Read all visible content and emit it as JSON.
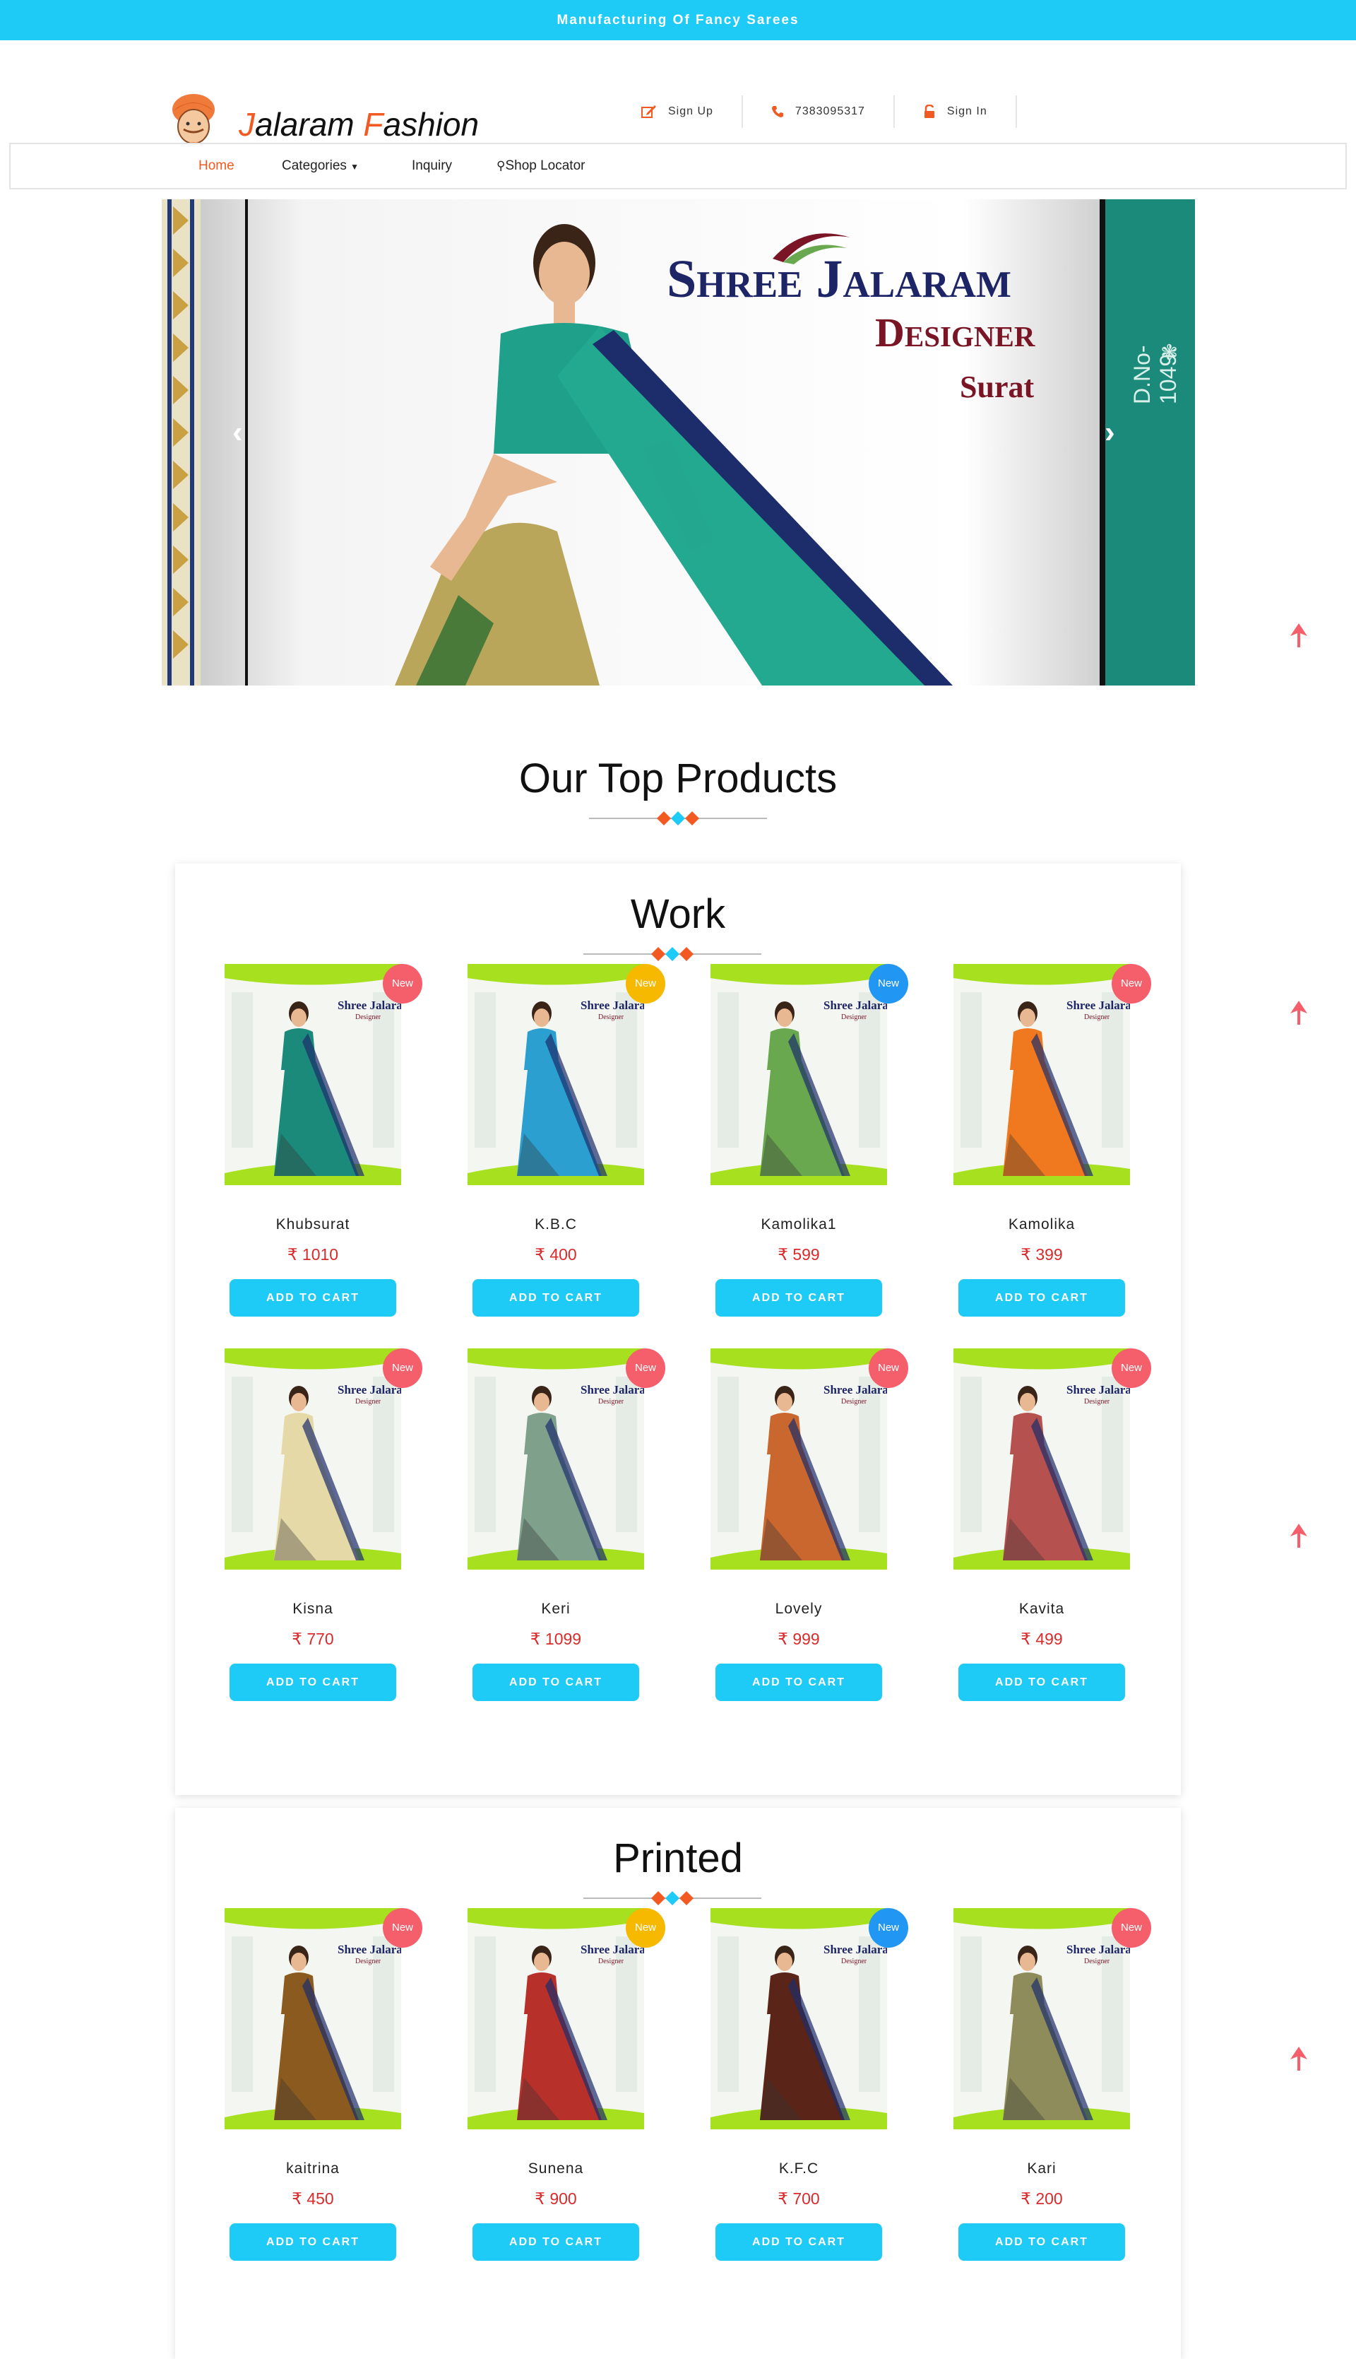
{
  "topbar": {
    "text": "Manufacturing Of Fancy Sarees"
  },
  "header": {
    "logo": {
      "first": "J",
      "first_rest": "alaram ",
      "second": "F",
      "second_rest": "ashion"
    },
    "links": [
      {
        "label": "Sign Up",
        "icon": "edit-icon"
      },
      {
        "label": "7383095317",
        "icon": "phone-icon"
      },
      {
        "label": "Sign In",
        "icon": "unlock-icon"
      }
    ]
  },
  "nav": {
    "home": "Home",
    "categories": "Categories",
    "inquiry": "Inquiry",
    "shop_locator": "Shop Locator"
  },
  "banner": {
    "brand_line1": "Shree Jalaram",
    "brand_line2": "Designer",
    "brand_line3": "Surat",
    "side_text": "D.No-1049",
    "prev": "‹",
    "next": "›"
  },
  "heading": "Our Top Products",
  "currency": "₹",
  "cart_label": "ADD TO CART",
  "badge_label": "New",
  "colors": {
    "accent": "#1ecaf6",
    "brand_orange": "#f15a22",
    "price_red": "#d92b2b",
    "badge_red": "#f55f6b",
    "badge_yellow": "#f7b800",
    "badge_blue": "#2196f3"
  },
  "sections": [
    {
      "title": "Work",
      "products": [
        {
          "name": "Khubsurat",
          "price": "1010",
          "badge_color": "#f55f6b",
          "saree_color": "#1c8a7b"
        },
        {
          "name": "K.B.C",
          "price": "400",
          "badge_color": "#f7b800",
          "saree_color": "#2a9fd0"
        },
        {
          "name": "Kamolika1",
          "price": "599",
          "badge_color": "#2196f3",
          "saree_color": "#6aa84f"
        },
        {
          "name": "Kamolika",
          "price": "399",
          "badge_color": "#f55f6b",
          "saree_color": "#f0781e"
        },
        {
          "name": "Kisna",
          "price": "770",
          "badge_color": "#f55f6b",
          "saree_color": "#e6d9a8"
        },
        {
          "name": "Keri",
          "price": "1099",
          "badge_color": "#f55f6b",
          "saree_color": "#7fa08a"
        },
        {
          "name": "Lovely",
          "price": "999",
          "badge_color": "#f55f6b",
          "saree_color": "#c9672f"
        },
        {
          "name": "Kavita",
          "price": "499",
          "badge_color": "#f55f6b",
          "saree_color": "#b5524f"
        }
      ]
    },
    {
      "title": "Printed",
      "products": [
        {
          "name": "kaitrina",
          "price": "450",
          "badge_color": "#f55f6b",
          "saree_color": "#8a5a1e"
        },
        {
          "name": "Sunena",
          "price": "900",
          "badge_color": "#f7b800",
          "saree_color": "#b8302a"
        },
        {
          "name": "K.F.C",
          "price": "700",
          "badge_color": "#2196f3",
          "saree_color": "#5a2418"
        },
        {
          "name": "Kari",
          "price": "200",
          "badge_color": "#f55f6b",
          "saree_color": "#8e8c5a"
        }
      ]
    }
  ]
}
